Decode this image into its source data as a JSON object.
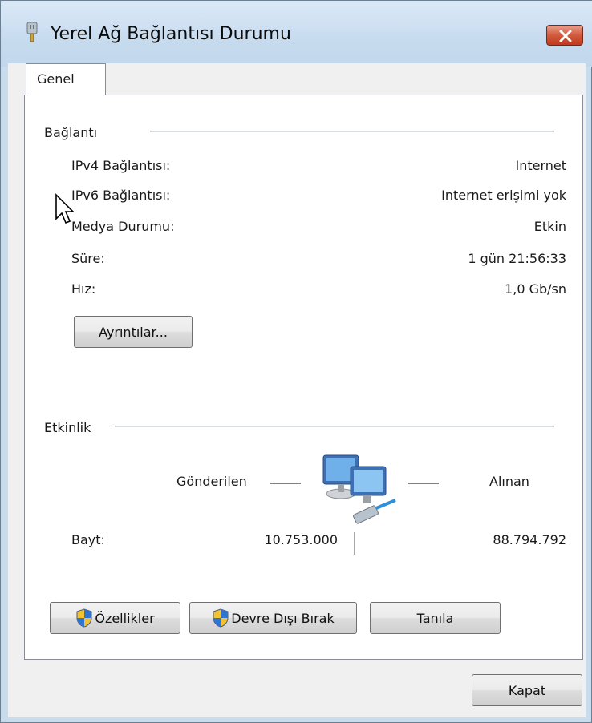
{
  "window": {
    "title": "Yerel Ağ Bağlantısı Durumu"
  },
  "tabs": [
    {
      "label": "Genel"
    }
  ],
  "connection": {
    "heading": "Bağlantı",
    "rows": [
      {
        "label": "IPv4 Bağlantısı:",
        "value": "Internet"
      },
      {
        "label": "IPv6 Bağlantısı:",
        "value": "Internet erişimi yok"
      },
      {
        "label": "Medya Durumu:",
        "value": "Etkin"
      },
      {
        "label": "Süre:",
        "value": "1 gün 21:56:33"
      },
      {
        "label": "Hız:",
        "value": "1,0 Gb/sn"
      }
    ],
    "details_button": "Ayrıntılar..."
  },
  "activity": {
    "heading": "Etkinlik",
    "sent_label": "Gönderilen",
    "received_label": "Alınan",
    "bytes_label": "Bayt:",
    "bytes_sent": "10.753.000",
    "bytes_received": "88.794.792"
  },
  "buttons": {
    "properties": "Özellikler",
    "disable": "Devre Dışı Bırak",
    "diagnose": "Tanıla",
    "close": "Kapat"
  },
  "icons": {
    "title": "network-adapter-icon",
    "close": "close-icon",
    "shield": "uac-shield-icon",
    "network": "network-computers-icon",
    "cursor": "mouse-cursor-icon"
  }
}
